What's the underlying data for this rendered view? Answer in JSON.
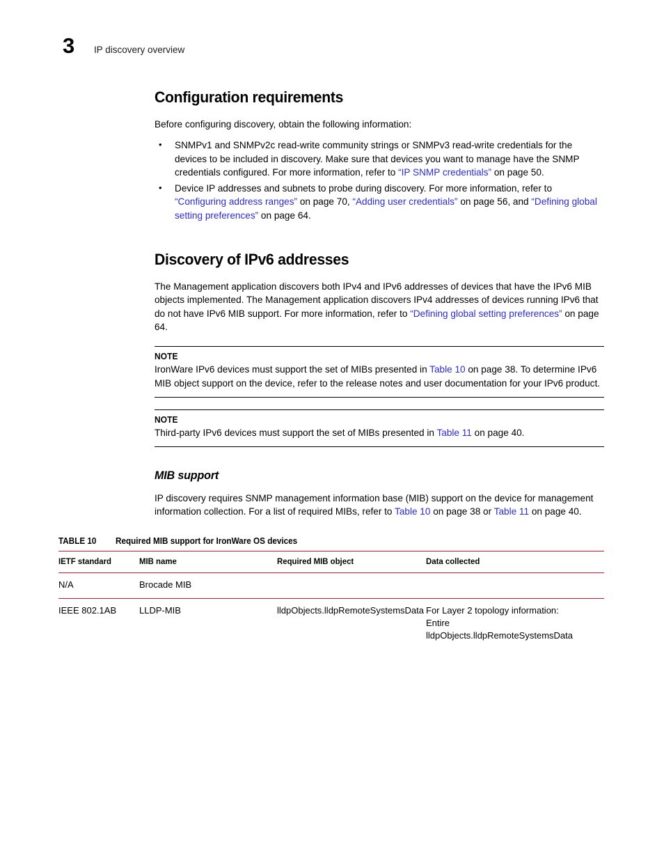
{
  "page": {
    "chapter_number": "3",
    "running_head": "IP discovery overview",
    "link_color": "#2b2bd4",
    "rule_color": "#e2162a"
  },
  "sections": {
    "configuration_requirements": {
      "heading": "Configuration requirements",
      "intro": "Before configuring discovery, obtain the following information:",
      "bullet_glyph": "•",
      "bullets": [
        {
          "part1": "SNMPv1 and SNMPv2c read-write community strings or SNMPv3 read-write credentials for the devices to be included in discovery. Make sure that devices you want to manage have the SNMP credentials configured. For more information, refer to ",
          "link1": "“IP SNMP credentials”",
          "part2": " on page 50."
        },
        {
          "part1": "Device IP addresses and subnets to probe during discovery. For more information, refer to ",
          "link1": "“Configuring address ranges”",
          "part2": " on page 70, ",
          "link2": "“Adding user credentials”",
          "part3": " on page 56, and ",
          "link3": "“Defining global setting preferences”",
          "part4": " on page 64."
        }
      ]
    },
    "discovery_ipv6": {
      "heading": "Discovery of IPv6 addresses",
      "para": {
        "part1": "The Management application discovers both IPv4 and IPv6 addresses of devices that have the IPv6 MIB objects implemented. The Management application discovers IPv4 addresses of devices running IPv6 that do not have IPv6 MIB support. For more information, refer to ",
        "link1": "“Defining global setting preferences”",
        "part2": " on page 64."
      }
    },
    "notes": [
      {
        "label": "NOTE",
        "part1": "IronWare IPv6 devices must support the set of MIBs presented in ",
        "link1": "Table 10",
        "part2": " on page 38. To determine IPv6 MIB object support on the device, refer to the release notes and user documentation for your IPv6 product."
      },
      {
        "label": "NOTE",
        "part1": "Third-party IPv6 devices must support the set of MIBs presented in ",
        "link1": "Table 11",
        "part2": " on page 40."
      }
    ],
    "mib_support": {
      "heading": "MIB support",
      "para": {
        "part1": "IP discovery requires SNMP management information base (MIB) support on the device for management information collection. For a list of required MIBs, refer to ",
        "link1": "Table 10",
        "part2": " on page 38 or ",
        "link2": "Table 11",
        "part3": " on page 40."
      }
    }
  },
  "table": {
    "caption_number": "TABLE 10",
    "caption_title": "Required MIB support for IronWare OS devices",
    "columns": [
      "IETF standard",
      "MIB name",
      "Required MIB object",
      "Data collected"
    ],
    "rows": [
      {
        "ietf_standard": "N/A",
        "mib_name": "Brocade MIB",
        "required_mib_object": "",
        "data_collected_line1": "",
        "data_collected_line2": ""
      },
      {
        "ietf_standard": "IEEE 802.1AB",
        "mib_name": "LLDP-MIB",
        "required_mib_object": "lldpObjects.lldpRemoteSystemsData",
        "data_collected_line1": "For Layer 2 topology information:",
        "data_collected_line2": "Entire lldpObjects.lldpRemoteSystemsData"
      }
    ]
  }
}
